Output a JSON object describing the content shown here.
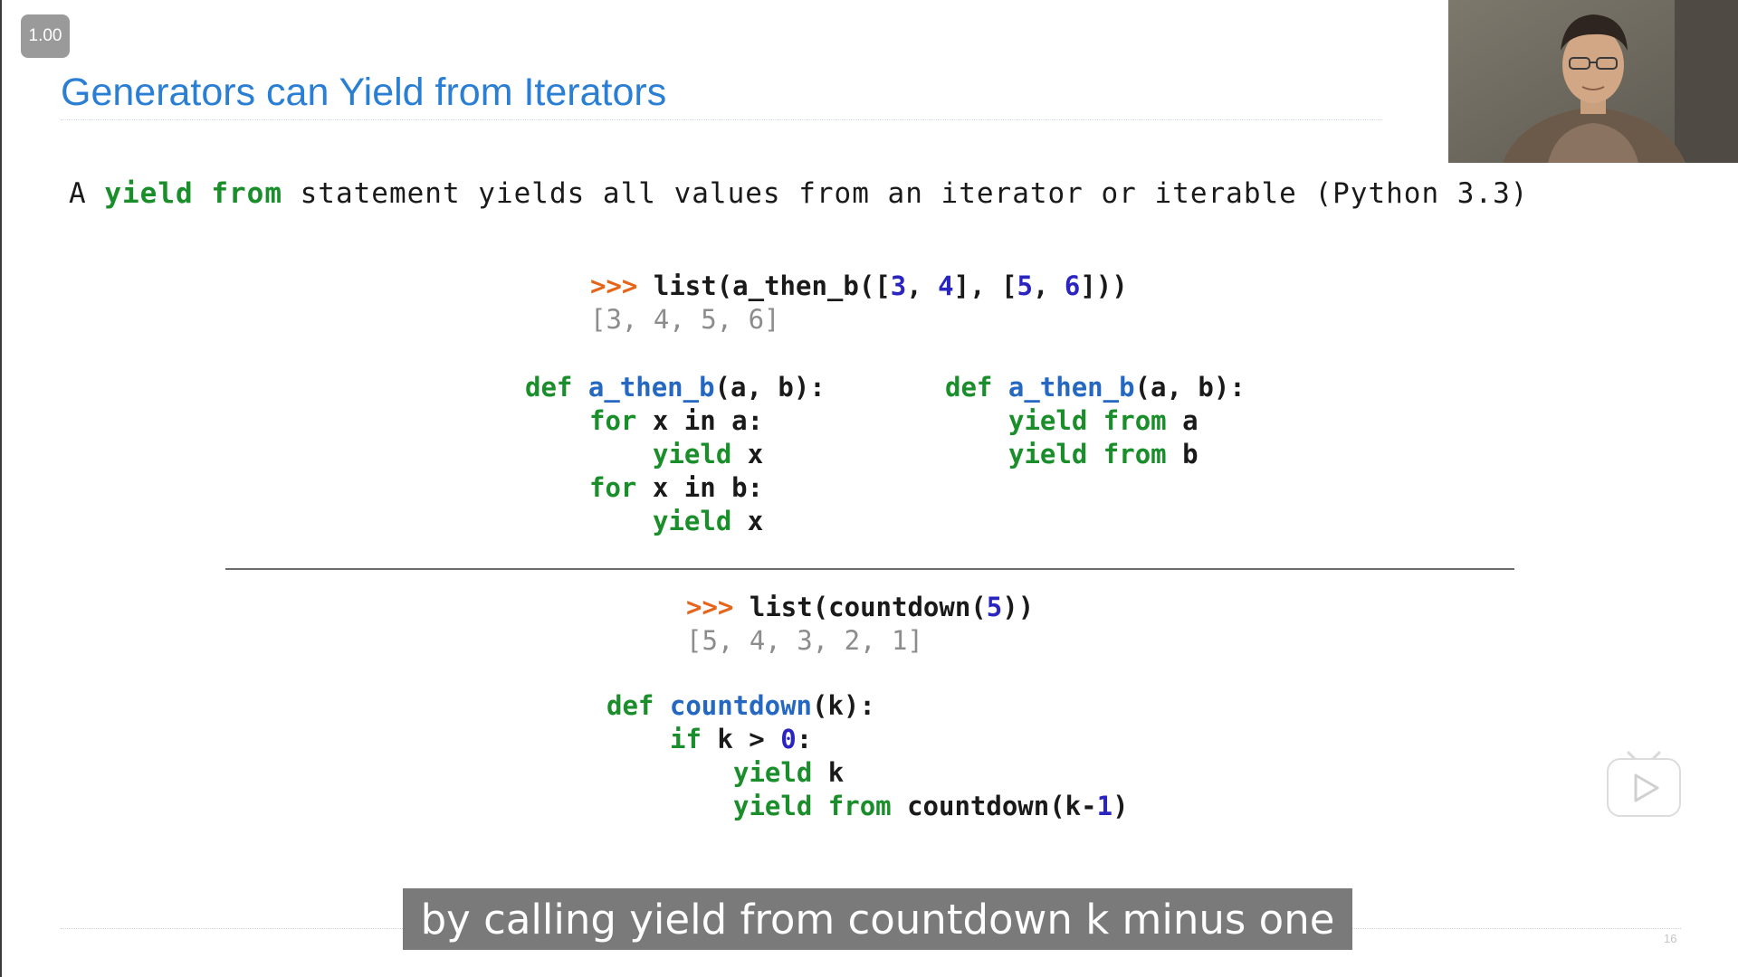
{
  "player": {
    "speed_label": "1.00"
  },
  "slide": {
    "title": "Generators can Yield from Iterators",
    "intro": {
      "prefix": "A ",
      "kw_yield": "yield",
      "kw_from": "from",
      "rest": " statement yields all values from an iterator or iterable (Python 3.3)"
    },
    "ex1": {
      "prompt": ">>>",
      "call_open": "list(a_then_b([",
      "n1": "3",
      "sep1": ", ",
      "n2": "4",
      "mid": "], [",
      "n3": "5",
      "sep2": ", ",
      "n4": "6",
      "close": "]))",
      "output": "[3, 4, 5, 6]"
    },
    "code_left": {
      "def_kw": "def",
      "fn_name": "a_then_b",
      "sig": "(a, b):",
      "for_kw": "for",
      "loop_a": " x in a:",
      "loop_b": " x in b:",
      "yield_kw": "yield",
      "yield_var": " x"
    },
    "code_right": {
      "def_kw": "def",
      "fn_name": "a_then_b",
      "sig": "(a, b):",
      "yield_kw": "yield",
      "from_kw": "from",
      "var_a": " a",
      "var_b": " b"
    },
    "ex2": {
      "prompt": ">>>",
      "call_open": "list(countdown(",
      "n": "5",
      "close": "))",
      "output": "[5, 4, 3, 2, 1]"
    },
    "code_countdown": {
      "def_kw": "def",
      "fn_name": "countdown",
      "sig": "(k):",
      "if_kw": "if",
      "cond": " k > ",
      "zero": "0",
      "colon": ":",
      "yield_kw": "yield",
      "yield_var": " k",
      "from_kw": "from",
      "recurse_open": " countdown(k-",
      "one": "1",
      "recurse_close": ")"
    },
    "page_number": "16"
  },
  "subtitle": {
    "text": "by calling yield from countdown k minus one"
  },
  "colors": {
    "title": "#2a7fd4",
    "keyword": "#1a8e2a",
    "function": "#2468c2",
    "number": "#2a25c0",
    "prompt": "#e5651a",
    "output": "#8c8c8c"
  }
}
